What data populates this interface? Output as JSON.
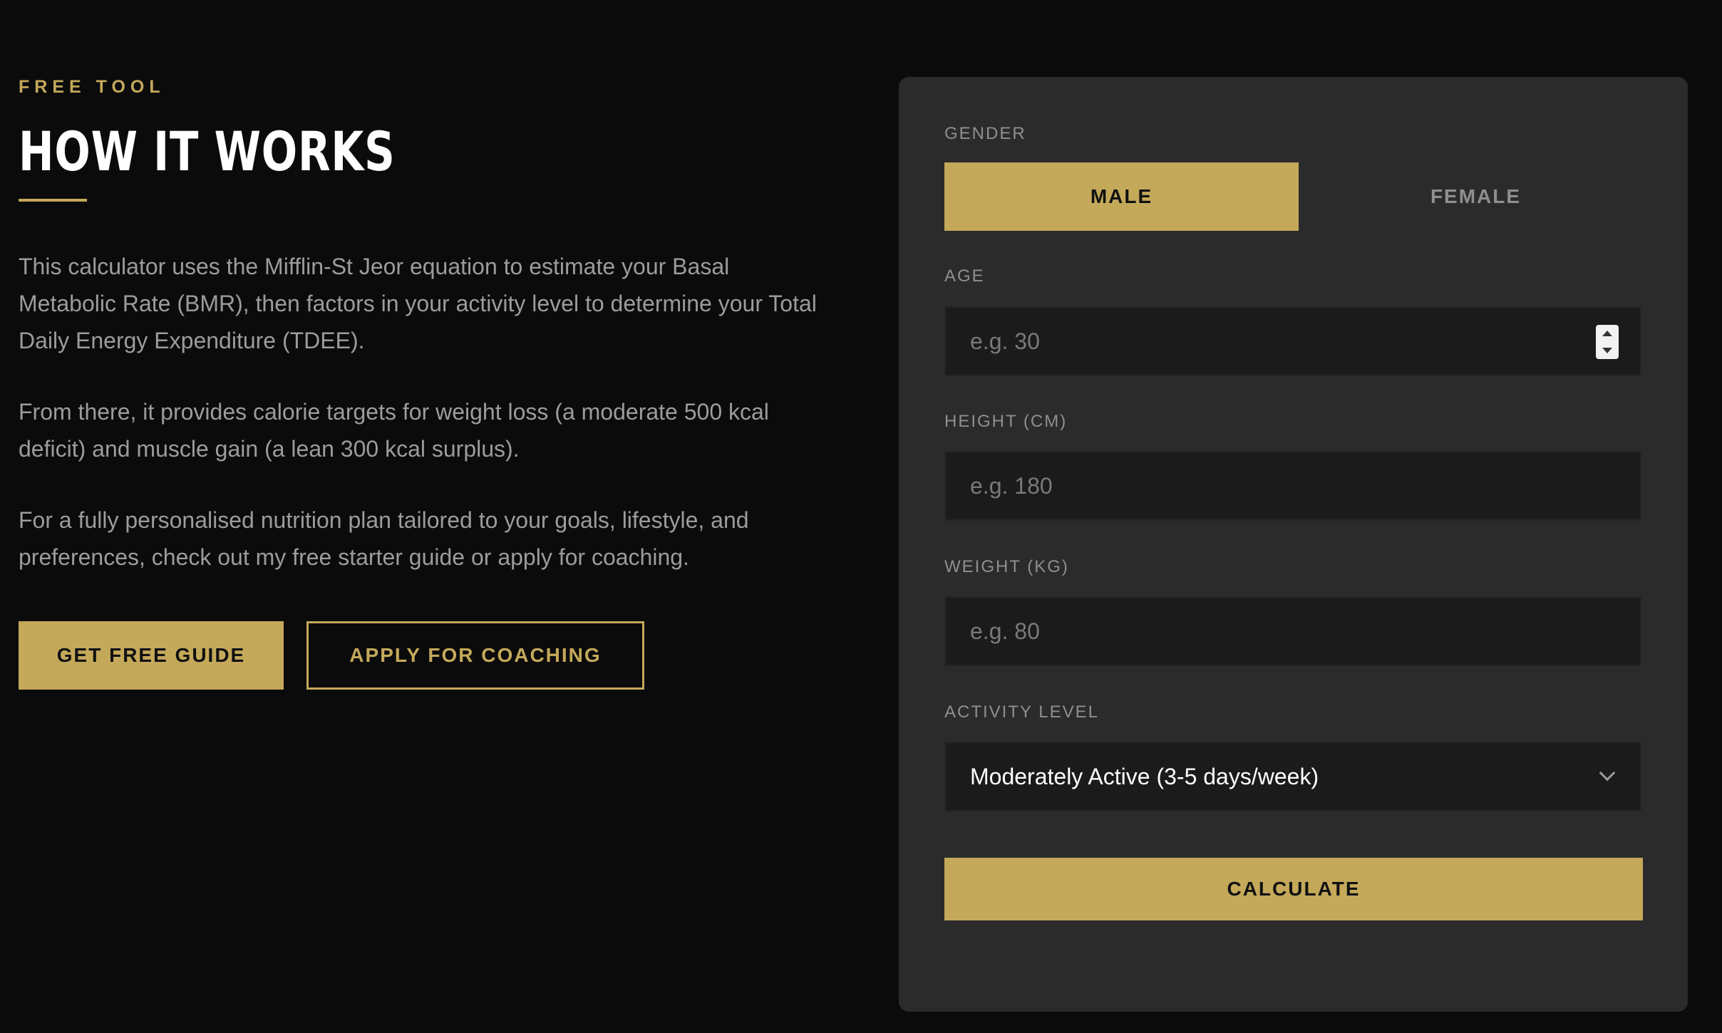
{
  "colors": {
    "background": "#0b0b0b",
    "card": "#2b2b2b",
    "accent": "#c4a95a",
    "input_bg": "#1b1b1b",
    "text_muted": "#9c9c9c"
  },
  "info": {
    "eyebrow": "FREE TOOL",
    "title": "HOW IT WORKS",
    "paragraphs": [
      "This calculator uses the Mifflin-St Jeor equation to estimate your Basal Metabolic Rate (BMR), then factors in your activity level to determine your Total Daily Energy Expenditure (TDEE).",
      "From there, it provides calorie targets for weight loss (a moderate 500 kcal deficit) and muscle gain (a lean 300 kcal surplus).",
      "For a fully personalised nutrition plan tailored to your goals, lifestyle, and preferences, check out my free starter guide or apply for coaching."
    ],
    "buttons": {
      "guide": "GET FREE GUIDE",
      "coaching": "APPLY FOR COACHING"
    }
  },
  "calculator": {
    "gender": {
      "label": "GENDER",
      "options": [
        "MALE",
        "FEMALE"
      ],
      "selected": "MALE"
    },
    "age": {
      "label": "AGE",
      "value": "",
      "placeholder": "e.g. 30",
      "stepper_icons": [
        "chevron-up-icon",
        "chevron-down-icon"
      ]
    },
    "height": {
      "label": "HEIGHT (CM)",
      "value": "",
      "placeholder": "e.g. 180"
    },
    "weight": {
      "label": "WEIGHT (KG)",
      "value": "",
      "placeholder": "e.g. 80"
    },
    "activity": {
      "label": "ACTIVITY LEVEL",
      "selected": "Moderately Active (3-5 days/week)",
      "icon": "chevron-down-icon"
    },
    "submit_label": "CALCULATE"
  }
}
